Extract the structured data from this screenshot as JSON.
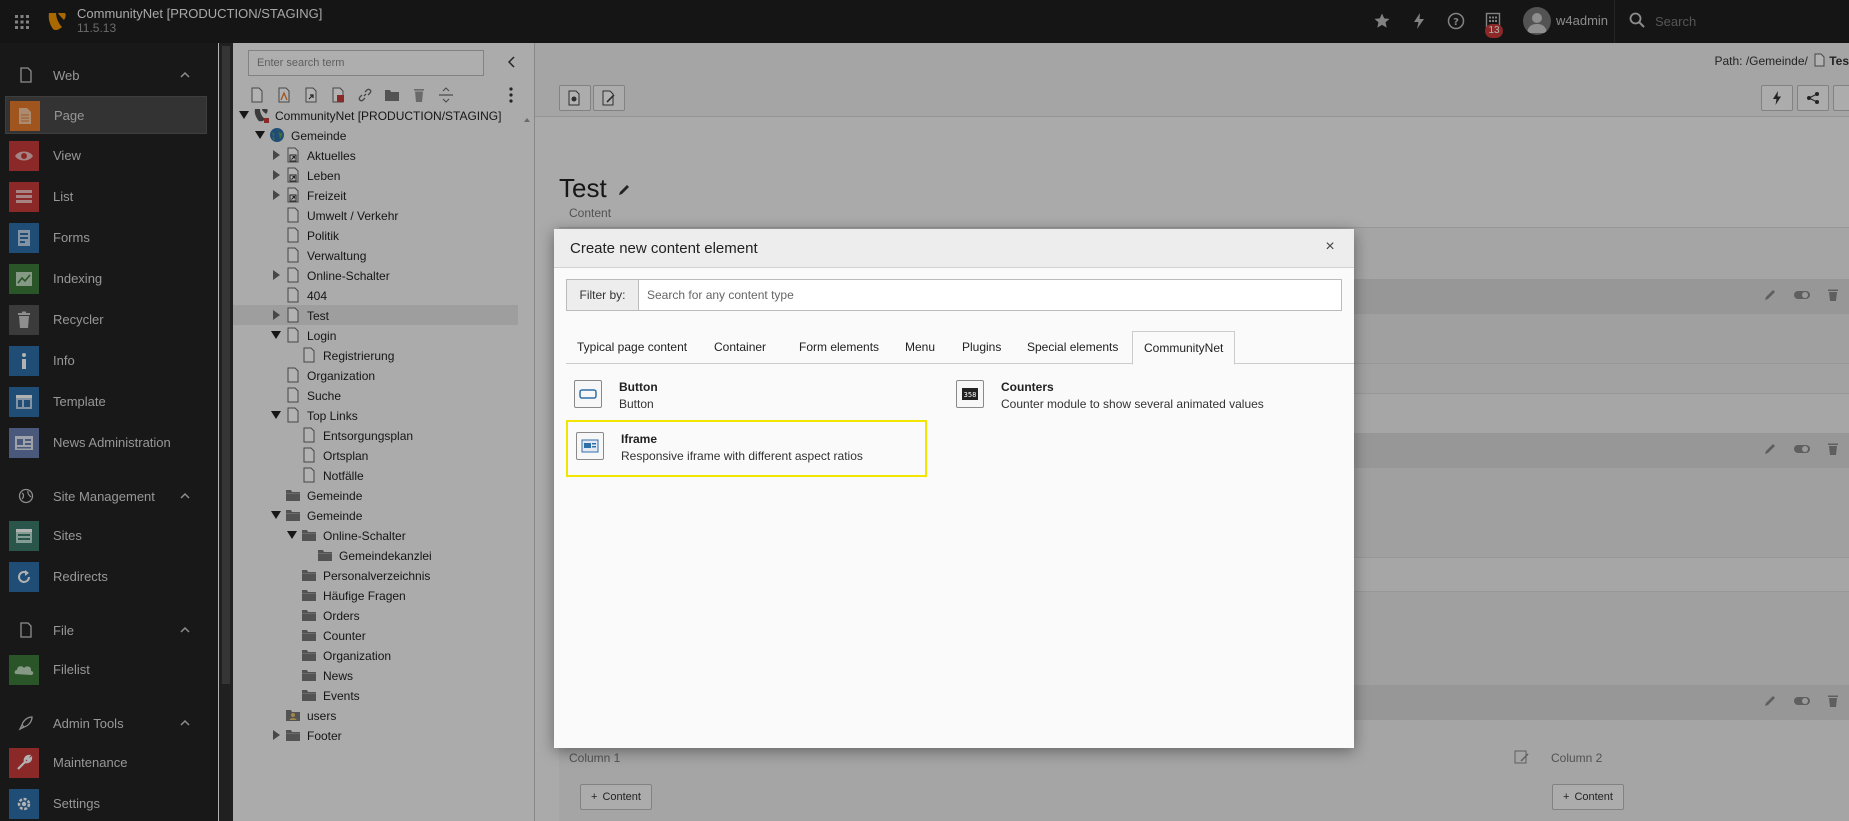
{
  "topbar": {
    "site_name": "CommunityNet [PRODUCTION/STAGING]",
    "site_version": "11.5.13",
    "notification_count": "13",
    "username": "w4admin",
    "search_placeholder": "Search"
  },
  "module_menu": {
    "groups": [
      {
        "label": "Web",
        "icon": "page-icon",
        "items": [
          {
            "label": "Page",
            "icon": "page-module-icon",
            "color": "#e6792b",
            "active": true
          },
          {
            "label": "View",
            "icon": "eye-icon",
            "color": "#c83c3c"
          },
          {
            "label": "List",
            "icon": "list-icon",
            "color": "#c83c3c"
          },
          {
            "label": "Forms",
            "icon": "forms-icon",
            "color": "#2f6fa8"
          },
          {
            "label": "Indexing",
            "icon": "indexing-icon",
            "color": "#3b7a3b"
          },
          {
            "label": "Recycler",
            "icon": "trash-icon",
            "color": "#555555"
          },
          {
            "label": "Info",
            "icon": "info-icon",
            "color": "#2f6fa8"
          },
          {
            "label": "Template",
            "icon": "template-icon",
            "color": "#2f6fa8"
          },
          {
            "label": "News Administration",
            "icon": "news-icon",
            "color": "#6a7fb0"
          }
        ]
      },
      {
        "label": "Site Management",
        "icon": "globe-icon",
        "items": [
          {
            "label": "Sites",
            "icon": "sites-icon",
            "color": "#3b7a6a"
          },
          {
            "label": "Redirects",
            "icon": "redirects-icon",
            "color": "#2f6fa8"
          }
        ]
      },
      {
        "label": "File",
        "icon": "file-icon",
        "items": [
          {
            "label": "Filelist",
            "icon": "filelist-icon",
            "color": "#3b7a3b"
          }
        ]
      },
      {
        "label": "Admin Tools",
        "icon": "rocket-icon",
        "items": [
          {
            "label": "Maintenance",
            "icon": "wrench-icon",
            "color": "#c83c3c"
          },
          {
            "label": "Settings",
            "icon": "gear-icon",
            "color": "#2f6fa8"
          }
        ]
      }
    ]
  },
  "page_tree": {
    "search_placeholder": "Enter search term",
    "nodes": [
      {
        "label": "CommunityNet [PRODUCTION/STAGING]",
        "depth": 0,
        "toggle": "open",
        "icon": "typo3"
      },
      {
        "label": "Gemeinde",
        "depth": 1,
        "toggle": "open",
        "icon": "globe"
      },
      {
        "label": "Aktuelles",
        "depth": 2,
        "toggle": "closed",
        "icon": "page-shortcut"
      },
      {
        "label": "Leben",
        "depth": 2,
        "toggle": "closed",
        "icon": "page-shortcut"
      },
      {
        "label": "Freizeit",
        "depth": 2,
        "toggle": "closed",
        "icon": "page-shortcut"
      },
      {
        "label": "Umwelt / Verkehr",
        "depth": 2,
        "toggle": "none",
        "icon": "page"
      },
      {
        "label": "Politik",
        "depth": 2,
        "toggle": "none",
        "icon": "page"
      },
      {
        "label": "Verwaltung",
        "depth": 2,
        "toggle": "none",
        "icon": "page"
      },
      {
        "label": "Online-Schalter",
        "depth": 2,
        "toggle": "closed",
        "icon": "page"
      },
      {
        "label": "404",
        "depth": 2,
        "toggle": "none",
        "icon": "page"
      },
      {
        "label": "Test",
        "depth": 2,
        "toggle": "closed",
        "icon": "page",
        "selected": true
      },
      {
        "label": "Login",
        "depth": 2,
        "toggle": "open",
        "icon": "page"
      },
      {
        "label": "Registrierung",
        "depth": 3,
        "toggle": "none",
        "icon": "page"
      },
      {
        "label": "Organization",
        "depth": 2,
        "toggle": "none",
        "icon": "page"
      },
      {
        "label": "Suche",
        "depth": 2,
        "toggle": "none",
        "icon": "page"
      },
      {
        "label": "Top Links",
        "depth": 2,
        "toggle": "open",
        "icon": "page"
      },
      {
        "label": "Entsorgungsplan",
        "depth": 3,
        "toggle": "none",
        "icon": "page"
      },
      {
        "label": "Ortsplan",
        "depth": 3,
        "toggle": "none",
        "icon": "page"
      },
      {
        "label": "Notfälle",
        "depth": 3,
        "toggle": "none",
        "icon": "page"
      },
      {
        "label": "Gemeinde",
        "depth": 2,
        "toggle": "none",
        "icon": "folder"
      },
      {
        "label": "Gemeinde",
        "depth": 2,
        "toggle": "open",
        "icon": "folder"
      },
      {
        "label": "Online-Schalter",
        "depth": 3,
        "toggle": "open",
        "icon": "folder"
      },
      {
        "label": "Gemeindekanzlei",
        "depth": 4,
        "toggle": "none",
        "icon": "folder"
      },
      {
        "label": "Personalverzeichnis",
        "depth": 3,
        "toggle": "none",
        "icon": "folder"
      },
      {
        "label": "Häufige Fragen",
        "depth": 3,
        "toggle": "none",
        "icon": "folder"
      },
      {
        "label": "Orders",
        "depth": 3,
        "toggle": "none",
        "icon": "folder"
      },
      {
        "label": "Counter",
        "depth": 3,
        "toggle": "none",
        "icon": "folder"
      },
      {
        "label": "Organization",
        "depth": 3,
        "toggle": "none",
        "icon": "folder"
      },
      {
        "label": "News",
        "depth": 3,
        "toggle": "none",
        "icon": "folder"
      },
      {
        "label": "Events",
        "depth": 3,
        "toggle": "none",
        "icon": "folder"
      },
      {
        "label": "users",
        "depth": 2,
        "toggle": "none",
        "icon": "folder-users"
      },
      {
        "label": "Footer",
        "depth": 2,
        "toggle": "closed",
        "icon": "folder"
      }
    ]
  },
  "content": {
    "path_prefix": "Path: /Gemeinde/",
    "path_current": "Tes",
    "page_title": "Test",
    "section_label": "Content",
    "column_1": "Column 1",
    "column_2": "Column 2",
    "add_content_label": "Content"
  },
  "modal": {
    "title": "Create new content element",
    "close_label": "×",
    "filter_label": "Filter by:",
    "filter_placeholder": "Search for any content type",
    "tabs": [
      {
        "label": "Typical page content"
      },
      {
        "label": "Container"
      },
      {
        "label": "Form elements"
      },
      {
        "label": "Menu"
      },
      {
        "label": "Plugins"
      },
      {
        "label": "Special elements"
      },
      {
        "label": "CommunityNet",
        "active": true
      }
    ],
    "elements": [
      {
        "name": "Button",
        "description": "Button",
        "icon": "button-icon"
      },
      {
        "name": "Counters",
        "description": "Counter module to show several animated values",
        "icon": "counter-icon"
      },
      {
        "name": "Iframe",
        "description": "Responsive iframe with different aspect ratios",
        "icon": "iframe-icon",
        "highlighted": true
      }
    ]
  }
}
